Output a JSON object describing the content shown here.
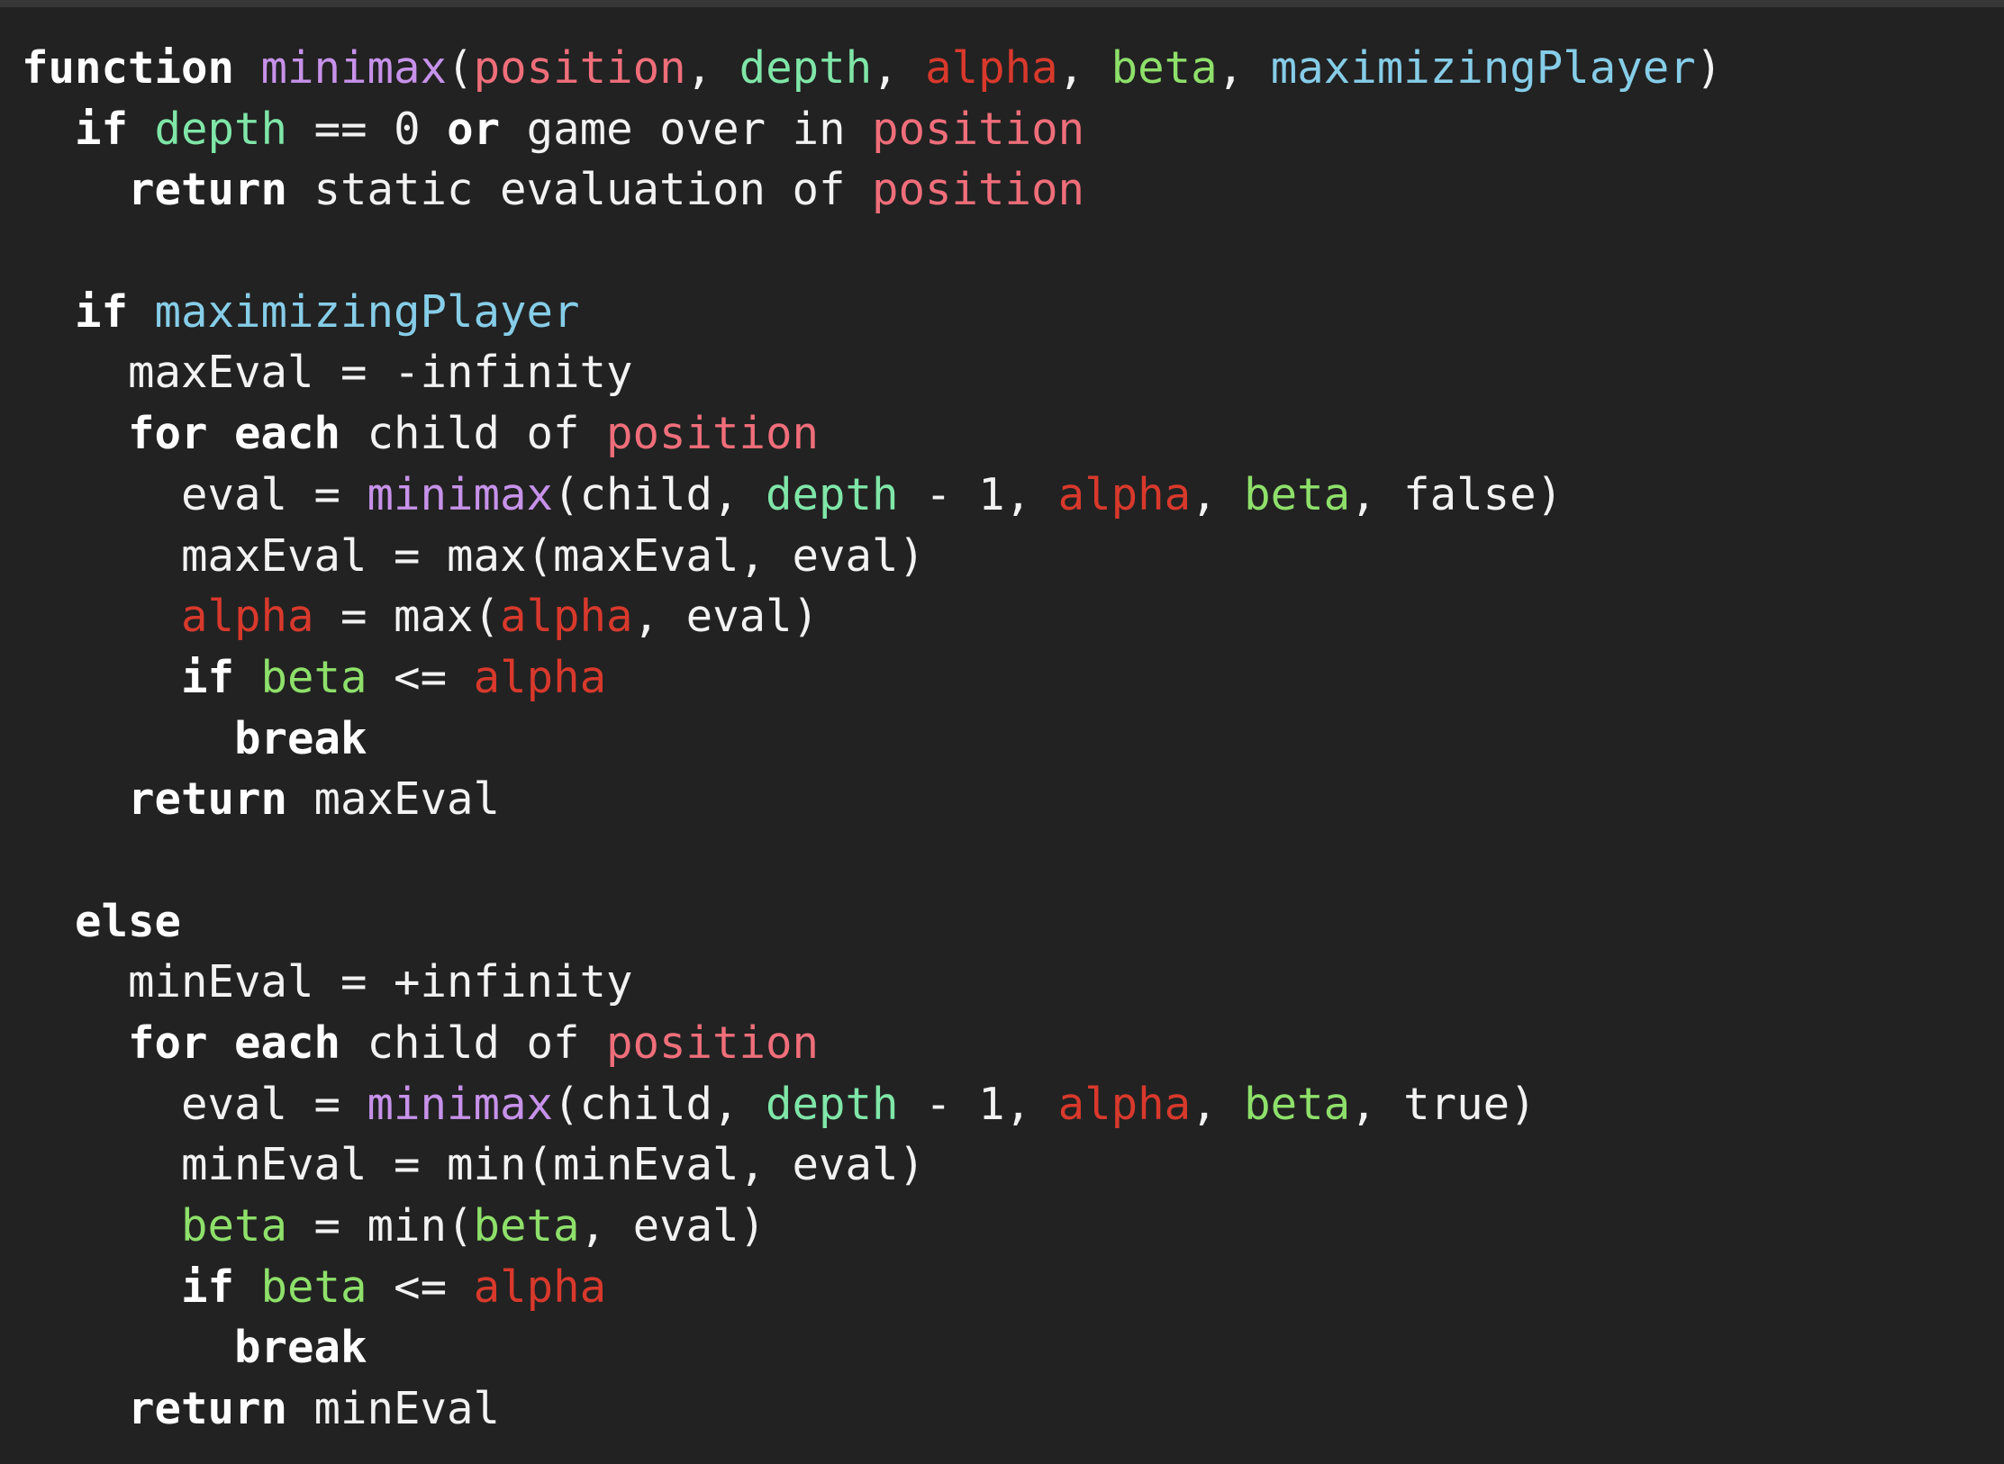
{
  "colors": {
    "background": "#222222",
    "text": "#f2f2f2",
    "keyword": "#ffffff",
    "function": "#c792ea",
    "position": "#ef6e7a",
    "depth": "#7fe6a8",
    "alpha": "#d8392c",
    "beta": "#8ee06a",
    "maximizingPlayer": "#86cde8"
  },
  "code": {
    "lines": [
      [
        {
          "t": "function",
          "c": "kw"
        },
        {
          "t": " ",
          "c": "txt"
        },
        {
          "t": "minimax",
          "c": "fn"
        },
        {
          "t": "(",
          "c": "txt"
        },
        {
          "t": "position",
          "c": "pos"
        },
        {
          "t": ", ",
          "c": "txt"
        },
        {
          "t": "depth",
          "c": "dep"
        },
        {
          "t": ", ",
          "c": "txt"
        },
        {
          "t": "alpha",
          "c": "alp"
        },
        {
          "t": ", ",
          "c": "txt"
        },
        {
          "t": "beta",
          "c": "bet"
        },
        {
          "t": ", ",
          "c": "txt"
        },
        {
          "t": "maximizingPlayer",
          "c": "mp"
        },
        {
          "t": ")",
          "c": "txt"
        }
      ],
      [
        {
          "t": "  ",
          "c": "txt"
        },
        {
          "t": "if",
          "c": "kw"
        },
        {
          "t": " ",
          "c": "txt"
        },
        {
          "t": "depth",
          "c": "dep"
        },
        {
          "t": " == 0 ",
          "c": "txt"
        },
        {
          "t": "or",
          "c": "kw"
        },
        {
          "t": " game over in ",
          "c": "txt"
        },
        {
          "t": "position",
          "c": "pos"
        }
      ],
      [
        {
          "t": "    ",
          "c": "txt"
        },
        {
          "t": "return",
          "c": "kw"
        },
        {
          "t": " static evaluation of ",
          "c": "txt"
        },
        {
          "t": "position",
          "c": "pos"
        }
      ],
      [],
      [
        {
          "t": "  ",
          "c": "txt"
        },
        {
          "t": "if",
          "c": "kw"
        },
        {
          "t": " ",
          "c": "txt"
        },
        {
          "t": "maximizingPlayer",
          "c": "mp"
        }
      ],
      [
        {
          "t": "    maxEval = -infinity",
          "c": "txt"
        }
      ],
      [
        {
          "t": "    ",
          "c": "txt"
        },
        {
          "t": "for each",
          "c": "kw"
        },
        {
          "t": " child of ",
          "c": "txt"
        },
        {
          "t": "position",
          "c": "pos"
        }
      ],
      [
        {
          "t": "      eval = ",
          "c": "txt"
        },
        {
          "t": "minimax",
          "c": "fn"
        },
        {
          "t": "(child, ",
          "c": "txt"
        },
        {
          "t": "depth",
          "c": "dep"
        },
        {
          "t": " - 1, ",
          "c": "txt"
        },
        {
          "t": "alpha",
          "c": "alp"
        },
        {
          "t": ", ",
          "c": "txt"
        },
        {
          "t": "beta",
          "c": "bet"
        },
        {
          "t": ", false)",
          "c": "txt"
        }
      ],
      [
        {
          "t": "      maxEval = max(maxEval, eval)",
          "c": "txt"
        }
      ],
      [
        {
          "t": "      ",
          "c": "txt"
        },
        {
          "t": "alpha",
          "c": "alp"
        },
        {
          "t": " = max(",
          "c": "txt"
        },
        {
          "t": "alpha",
          "c": "alp"
        },
        {
          "t": ", eval)",
          "c": "txt"
        }
      ],
      [
        {
          "t": "      ",
          "c": "txt"
        },
        {
          "t": "if",
          "c": "kw"
        },
        {
          "t": " ",
          "c": "txt"
        },
        {
          "t": "beta",
          "c": "bet"
        },
        {
          "t": " <= ",
          "c": "txt"
        },
        {
          "t": "alpha",
          "c": "alp"
        }
      ],
      [
        {
          "t": "        ",
          "c": "txt"
        },
        {
          "t": "break",
          "c": "kw"
        }
      ],
      [
        {
          "t": "    ",
          "c": "txt"
        },
        {
          "t": "return",
          "c": "kw"
        },
        {
          "t": " maxEval",
          "c": "txt"
        }
      ],
      [],
      [
        {
          "t": "  ",
          "c": "txt"
        },
        {
          "t": "else",
          "c": "kw"
        }
      ],
      [
        {
          "t": "    minEval = +infinity",
          "c": "txt"
        }
      ],
      [
        {
          "t": "    ",
          "c": "txt"
        },
        {
          "t": "for each",
          "c": "kw"
        },
        {
          "t": " child of ",
          "c": "txt"
        },
        {
          "t": "position",
          "c": "pos"
        }
      ],
      [
        {
          "t": "      eval = ",
          "c": "txt"
        },
        {
          "t": "minimax",
          "c": "fn"
        },
        {
          "t": "(child, ",
          "c": "txt"
        },
        {
          "t": "depth",
          "c": "dep"
        },
        {
          "t": " - 1, ",
          "c": "txt"
        },
        {
          "t": "alpha",
          "c": "alp"
        },
        {
          "t": ", ",
          "c": "txt"
        },
        {
          "t": "beta",
          "c": "bet"
        },
        {
          "t": ", true)",
          "c": "txt"
        }
      ],
      [
        {
          "t": "      minEval = min(minEval, eval)",
          "c": "txt"
        }
      ],
      [
        {
          "t": "      ",
          "c": "txt"
        },
        {
          "t": "beta",
          "c": "bet"
        },
        {
          "t": " = min(",
          "c": "txt"
        },
        {
          "t": "beta",
          "c": "bet"
        },
        {
          "t": ", eval)",
          "c": "txt"
        }
      ],
      [
        {
          "t": "      ",
          "c": "txt"
        },
        {
          "t": "if",
          "c": "kw"
        },
        {
          "t": " ",
          "c": "txt"
        },
        {
          "t": "beta",
          "c": "bet"
        },
        {
          "t": " <= ",
          "c": "txt"
        },
        {
          "t": "alpha",
          "c": "alp"
        }
      ],
      [
        {
          "t": "        ",
          "c": "txt"
        },
        {
          "t": "break",
          "c": "kw"
        }
      ],
      [
        {
          "t": "    ",
          "c": "txt"
        },
        {
          "t": "return",
          "c": "kw"
        },
        {
          "t": " minEval",
          "c": "txt"
        }
      ]
    ]
  }
}
